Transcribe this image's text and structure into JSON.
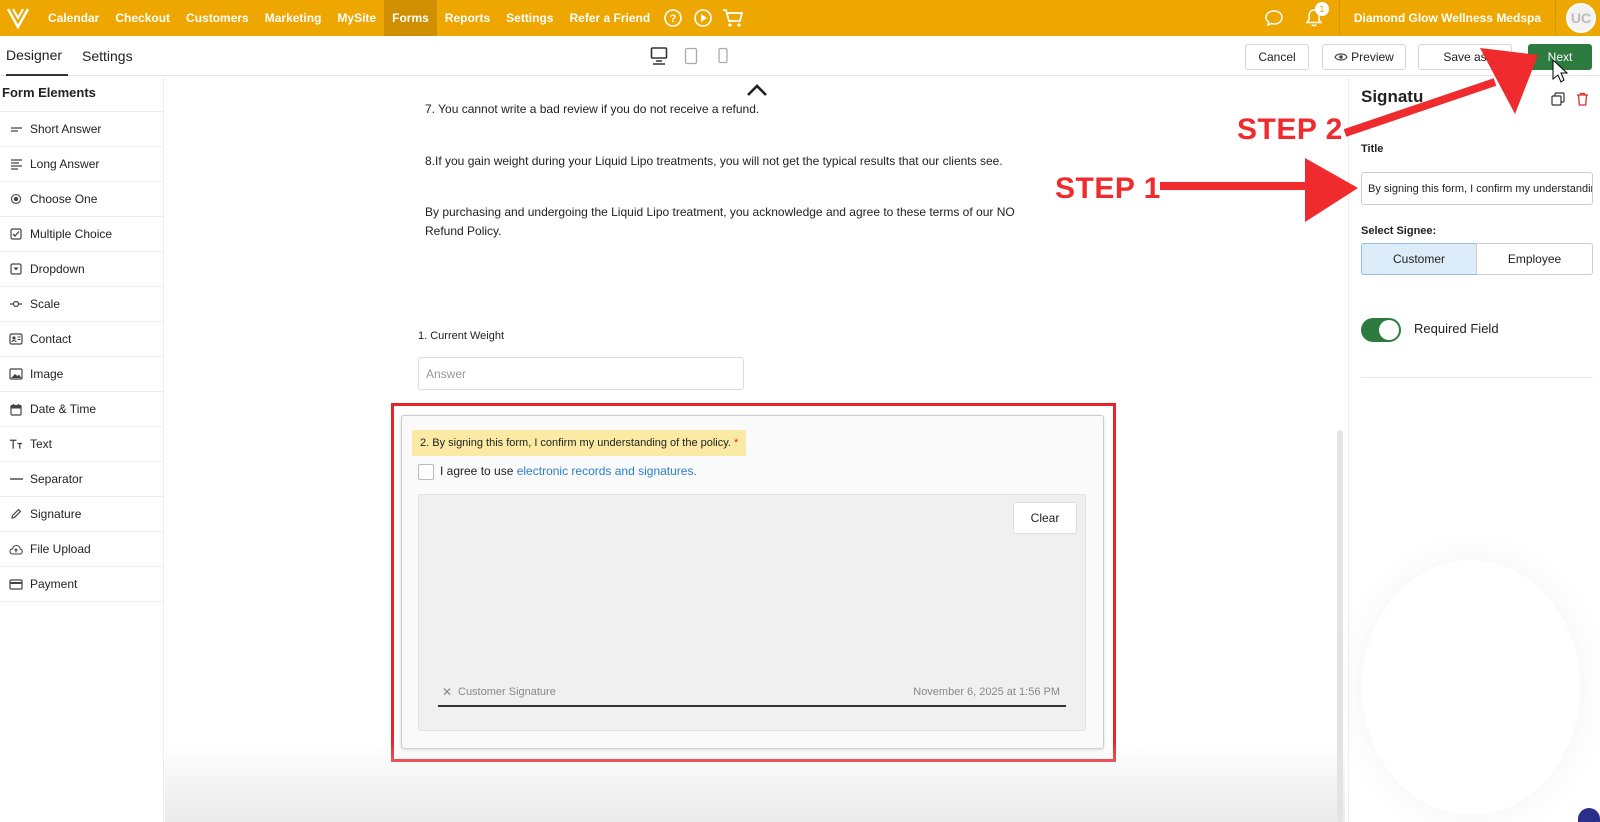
{
  "topnav": {
    "items": [
      "Calendar",
      "Checkout",
      "Customers",
      "Marketing",
      "MySite",
      "Forms",
      "Reports",
      "Settings",
      "Refer a Friend"
    ],
    "active": "Forms",
    "business_name": "Diamond Glow Wellness Medspa",
    "notification_count": "1",
    "avatar_initials": "UC",
    "accent_color": "#eea600"
  },
  "subheader": {
    "tabs": [
      "Designer",
      "Settings"
    ],
    "cancel": "Cancel",
    "preview": "Preview",
    "save_as": "Save as",
    "next": "Next"
  },
  "left_panel": {
    "title": "Form Elements",
    "items": [
      {
        "label": "Short Answer",
        "icon": "short-answer-icon"
      },
      {
        "label": "Long Answer",
        "icon": "long-answer-icon"
      },
      {
        "label": "Choose One",
        "icon": "radio-icon"
      },
      {
        "label": "Multiple Choice",
        "icon": "checkbox-icon"
      },
      {
        "label": "Dropdown",
        "icon": "dropdown-icon"
      },
      {
        "label": "Scale",
        "icon": "scale-icon"
      },
      {
        "label": "Contact",
        "icon": "contact-icon"
      },
      {
        "label": "Image",
        "icon": "image-icon"
      },
      {
        "label": "Date & Time",
        "icon": "calendar-icon"
      },
      {
        "label": "Text",
        "icon": "text-icon"
      },
      {
        "label": "Separator",
        "icon": "separator-icon"
      },
      {
        "label": "Signature",
        "icon": "pen-icon"
      },
      {
        "label": "File Upload",
        "icon": "upload-icon"
      },
      {
        "label": "Payment",
        "icon": "card-icon"
      }
    ]
  },
  "canvas": {
    "para7": "7. You cannot write a bad review if you do not receive a refund.",
    "para8": "8.If you gain weight during your Liquid Lipo treatments, you will not get the typical results that our clients see.",
    "para_ack_1": "By purchasing and undergoing the Liquid Lipo treatment, you acknowledge and agree to these terms of our NO",
    "para_ack_2": "Refund Policy.",
    "q1_label": "1. Current Weight",
    "q1_placeholder": "Answer",
    "q2_label": "2. By signing this form, I confirm my understanding of the policy.",
    "q2_required_mark": "*",
    "agree_text": "I agree to use ",
    "agree_link": "electronic records and signatures.",
    "clear": "Clear",
    "sig_x": "✕",
    "sig_name": "Customer Signature",
    "sig_date": "November 6, 2025 at 1:56 PM"
  },
  "right_panel": {
    "heading": "Signatu",
    "title_label": "Title",
    "title_value": "By signing this form, I confirm my understanding of the policy.",
    "signee_label": "Select Signee:",
    "signee_options": [
      "Customer",
      "Employee"
    ],
    "signee_selected": "Customer",
    "required_label": "Required Field",
    "required_on": true
  },
  "annotations": {
    "step1": "STEP 1",
    "step2": "STEP 2",
    "color": "#ef2b2d"
  }
}
